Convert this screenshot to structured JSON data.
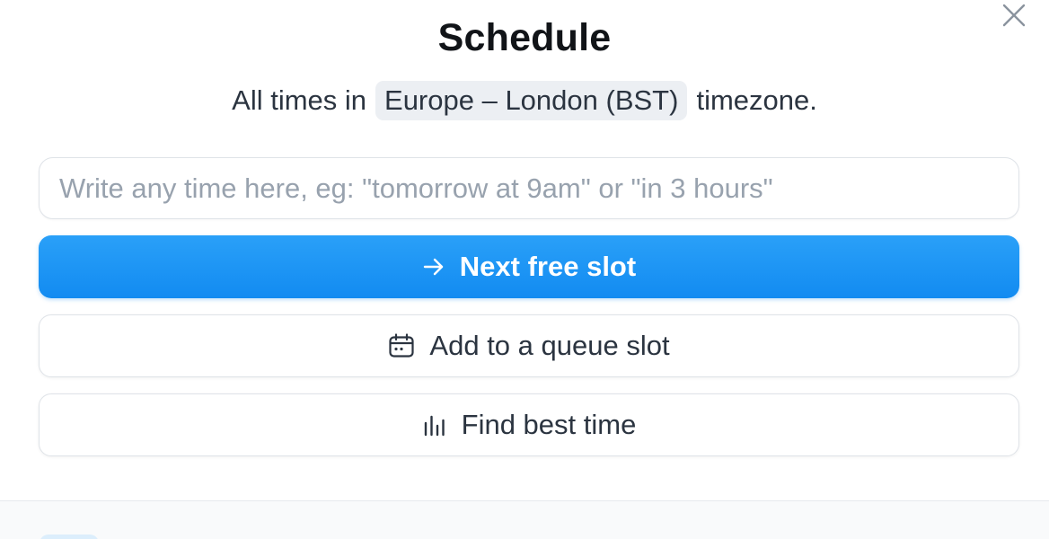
{
  "modal": {
    "title": "Schedule",
    "subtitle_prefix": "All times in",
    "timezone": "Europe – London (BST)",
    "subtitle_suffix": "timezone."
  },
  "time_input": {
    "value": "",
    "placeholder": "Write any time here, eg: \"tomorrow at 9am\" or \"in 3 hours\""
  },
  "buttons": {
    "next_free_slot": {
      "label": "Next free slot",
      "icon": "arrow-right-icon"
    },
    "add_to_queue": {
      "label": "Add to a queue slot",
      "icon": "calendar-icon"
    },
    "find_best_time": {
      "label": "Find best time",
      "icon": "bar-chart-icon"
    }
  },
  "close": {
    "icon": "close-icon"
  },
  "colors": {
    "primary": "#1a93f3",
    "text": "#2b3440",
    "title": "#111418",
    "badge_bg": "#eceff3",
    "border": "#dfe3e8"
  }
}
